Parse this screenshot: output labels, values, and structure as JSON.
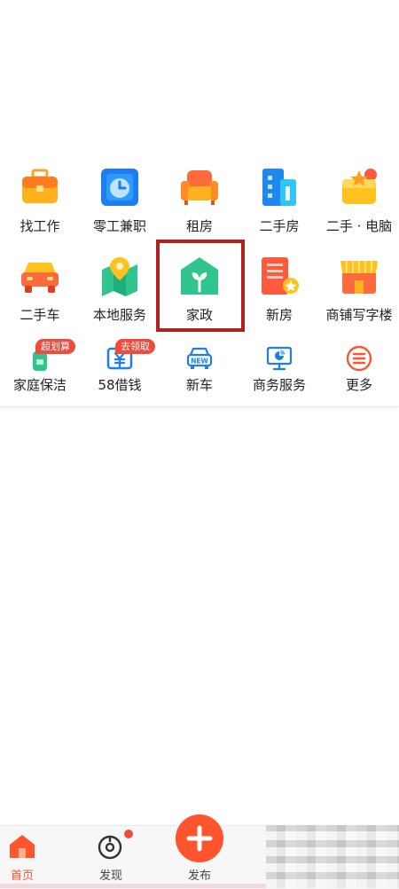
{
  "grid": {
    "row1": [
      {
        "label": "找工作",
        "icon": "briefcase-icon"
      },
      {
        "label": "零工兼职",
        "icon": "clock-icon"
      },
      {
        "label": "租房",
        "icon": "sofa-icon"
      },
      {
        "label": "二手房",
        "icon": "building-icon"
      },
      {
        "label": "二手 · 电脑",
        "icon": "box-star-icon"
      }
    ],
    "row2": [
      {
        "label": "二手车",
        "icon": "car-icon"
      },
      {
        "label": "本地服务",
        "icon": "map-pin-icon"
      },
      {
        "label": "家政",
        "icon": "house-sprout-icon"
      },
      {
        "label": "新房",
        "icon": "new-building-icon"
      },
      {
        "label": "商铺写字楼",
        "icon": "storefront-icon"
      }
    ],
    "row3": [
      {
        "label": "家庭保洁",
        "icon": "cleaning-icon",
        "badge": "超划算"
      },
      {
        "label": "58借钱",
        "icon": "yuan-ticket-icon",
        "badge": "去领取"
      },
      {
        "label": "新车",
        "icon": "new-car-icon",
        "icon_text": "NEW"
      },
      {
        "label": "商务服务",
        "icon": "monitor-chart-icon"
      },
      {
        "label": "更多",
        "icon": "menu-circle-icon"
      }
    ]
  },
  "highlighted_item": "家政",
  "tabs": [
    {
      "label": "首页",
      "icon": "home-icon",
      "active": true
    },
    {
      "label": "发现",
      "icon": "discover-icon",
      "has_dot": true
    },
    {
      "label": "发布",
      "icon": "plus-icon"
    }
  ],
  "colors": {
    "accent": "#ff552e",
    "highlight_box": "#b0211c",
    "badge": "#f04a3b",
    "house_green": "#2fc58d"
  }
}
